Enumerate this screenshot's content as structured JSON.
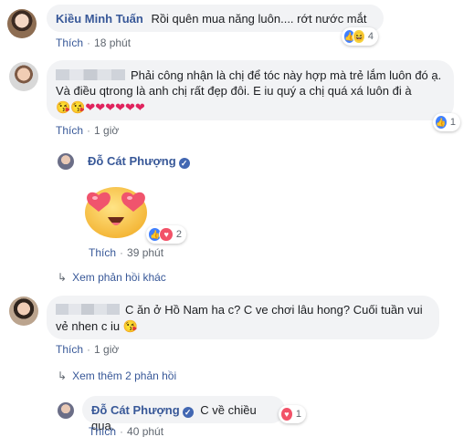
{
  "comments": [
    {
      "author": "Kiều Minh Tuấn",
      "text": "Rồi quên mua năng luôn.... rớt nước mắt",
      "like_label": "Thích",
      "time": "18 phút",
      "reaction_count": "4",
      "reaction_icons": [
        "like-icon",
        "haha-icon"
      ]
    },
    {
      "author_hidden": true,
      "text": "Phải công nhận là chị để tóc này hợp mà trẻ lắm luôn đó ạ. Và điều qtrong là anh chị rất đẹp đôi. E iu quý a chị quá xá luôn đi à",
      "emoji_line": [
        "kiss-emoji",
        "kiss-emoji",
        "heart",
        "heart",
        "heart",
        "heart",
        "heart",
        "heart"
      ],
      "like_label": "Thích",
      "time": "1 giờ",
      "reaction_count": "1",
      "reaction_icons": [
        "like-icon"
      ]
    }
  ],
  "reply1": {
    "author": "Đỗ Cát Phượng",
    "sticker": "heart-eyes-emoji-sticker",
    "like_label": "Thích",
    "time": "39 phút",
    "reaction_count": "2",
    "reaction_icons": [
      "like-icon",
      "love-icon"
    ]
  },
  "more_replies_1": "Xem phản hồi khác",
  "comment3": {
    "author_hidden": true,
    "text_part1": "C ăn ở Hồ Nam ha c? C ve chơi lâu hong? Cuối tuần vui",
    "text_part2": "vẻ nhen c iu",
    "like_label": "Thích",
    "time": "1 giờ"
  },
  "more_replies_2": "Xem thêm 2 phản hồi",
  "reply2": {
    "author": "Đỗ Cát Phượng",
    "text": "C về chiều qua.",
    "like_label": "Thích",
    "time": "40 phút",
    "reaction_count": "1",
    "reaction_icons": [
      "love-icon"
    ]
  },
  "colors": {
    "link": "#385898",
    "bubble": "#f2f3f5",
    "like": "#4080ff",
    "love": "#f25268",
    "meta": "#606770"
  }
}
